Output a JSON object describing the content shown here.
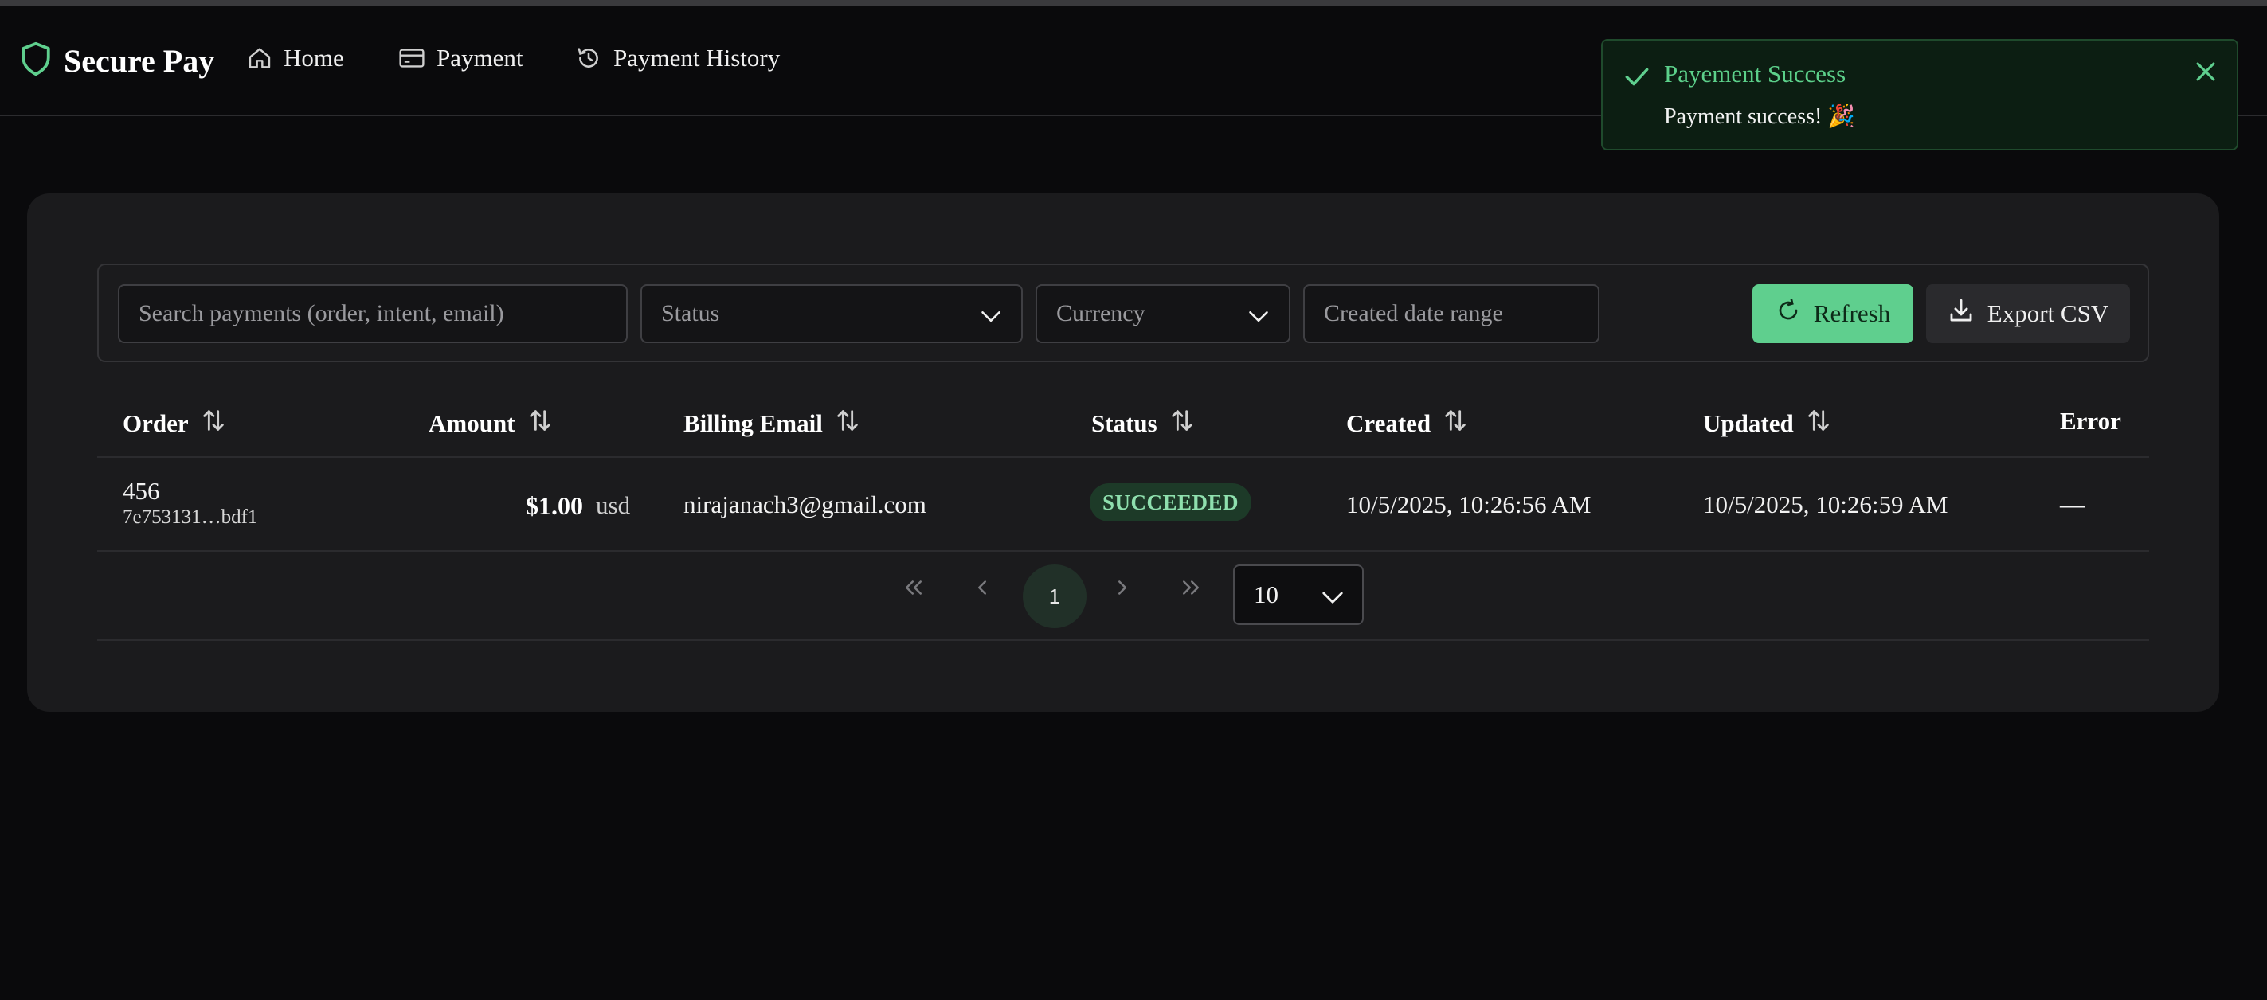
{
  "app": {
    "brand": "Secure Pay",
    "accent_color": "#5fcf8e",
    "icons": {
      "brand": "shield-icon",
      "home": "home-icon",
      "payment": "credit-card-icon",
      "history": "history-icon",
      "refresh": "refresh-icon",
      "export": "download-icon",
      "sort": "sort-icon"
    }
  },
  "nav": {
    "items": [
      {
        "label": "Home"
      },
      {
        "label": "Payment"
      },
      {
        "label": "Payment History"
      }
    ]
  },
  "toast": {
    "title": "Payement Success",
    "message": "Payment success! 🎉"
  },
  "filters": {
    "search_placeholder": "Search payments (order, intent, email)",
    "status_placeholder": "Status",
    "currency_placeholder": "Currency",
    "date_placeholder": "Created date range",
    "refresh_label": "Refresh",
    "export_label": "Export CSV"
  },
  "table": {
    "columns": [
      "Order",
      "Amount",
      "Billing Email",
      "Status",
      "Created",
      "Updated",
      "Error"
    ],
    "rows": [
      {
        "order": "456",
        "intent": "7e753131…bdf1",
        "amount": "$1.00",
        "currency": "usd",
        "email": "nirajanach3@gmail.com",
        "status": "SUCCEEDED",
        "created": "10/5/2025, 10:26:56 AM",
        "updated": "10/5/2025, 10:26:59 AM",
        "error": "—"
      }
    ]
  },
  "pagination": {
    "current_page": "1",
    "page_size": "10"
  }
}
